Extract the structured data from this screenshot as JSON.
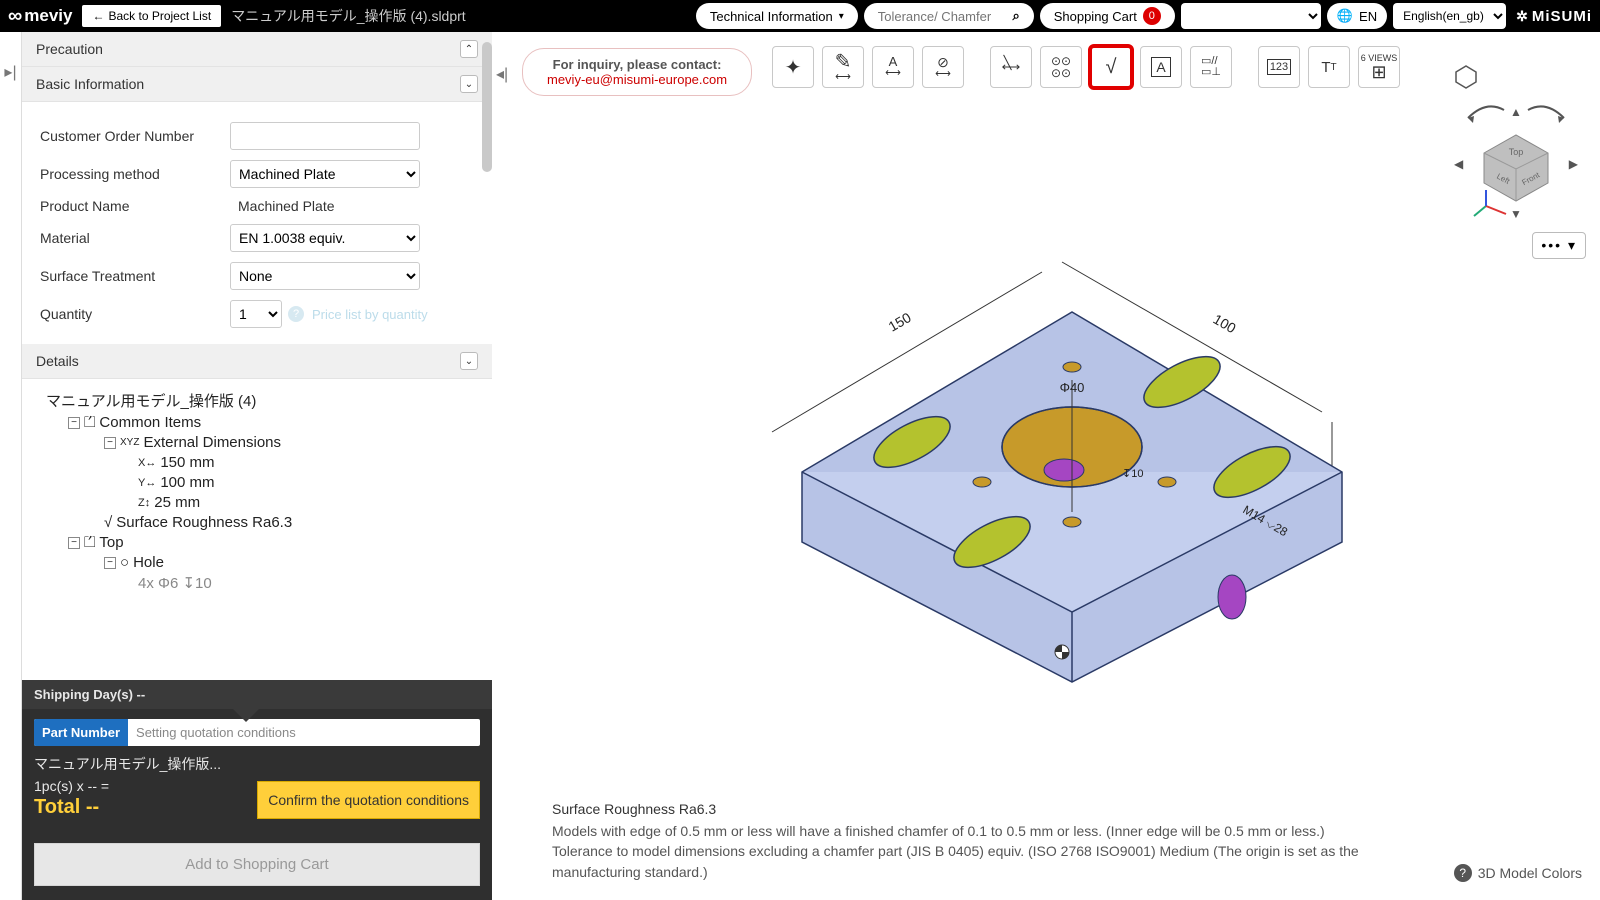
{
  "header": {
    "logo": "meviy",
    "back": "Back to Project List",
    "filename": "マニュアル用モデル_操作版 (4).sldprt",
    "tech_info": "Technical Information",
    "search_placeholder": "Tolerance/ Chamfer",
    "cart_label": "Shopping Cart",
    "cart_count": "0",
    "lang_short": "EN",
    "lang_select": "English(en_gb)",
    "brand2": "MiSUMi"
  },
  "sections": {
    "precaution": "Precaution",
    "basic": "Basic Information",
    "details": "Details"
  },
  "form": {
    "order_no_label": "Customer Order Number",
    "order_no_value": "",
    "proc_label": "Processing method",
    "proc_value": "Machined Plate",
    "product_label": "Product Name",
    "product_value": "Machined Plate",
    "material_label": "Material",
    "material_value": "EN 1.0038 equiv.",
    "surface_label": "Surface Treatment",
    "surface_value": "None",
    "qty_label": "Quantity",
    "qty_value": "1",
    "price_hint": "Price list by quantity"
  },
  "tree": {
    "root": "マニュアル用モデル_操作版 (4)",
    "common": "Common Items",
    "extdim": "External Dimensions",
    "dim_x": "150 mm",
    "dim_y": "100 mm",
    "dim_z": "25 mm",
    "rough": "Surface Roughness Ra6.3",
    "top": "Top",
    "hole": "Hole",
    "hole_detail": "4x Φ6 ↧10"
  },
  "quote": {
    "shipping": "Shipping Day(s) --",
    "pn_tag": "Part Number",
    "pn_hint": "Setting quotation conditions",
    "pname": "マニュアル用モデル_操作版...",
    "pcs": "1pc(s)  x -- =",
    "total": "Total --",
    "confirm": "Confirm the quotation conditions",
    "add_cart": "Add to Shopping Cart"
  },
  "viewer": {
    "inquiry_line1": "For inquiry, please contact:",
    "inquiry_email": "meviy-eu@misumi-europe.com",
    "note_title": "Surface Roughness Ra6.3",
    "note_line1": "Models with edge of 0.5 mm or less will have a finished chamfer of 0.1 to 0.5 mm or less. (Inner edge will be 0.5 mm or less.)",
    "note_line2": "Tolerance to model dimensions excluding a chamfer part (JIS B 0405) equiv. (ISO 2768 ISO9001) Medium (The origin is set as the manufacturing standard.)",
    "colors": "3D Model Colors",
    "dim_150": "150",
    "dim_100": "100",
    "dim_phi40": "Φ40",
    "dim_m14": "M14 ⌵28",
    "dim_depth": "↧10"
  },
  "toolbar_overflow": "6 VIEWS"
}
